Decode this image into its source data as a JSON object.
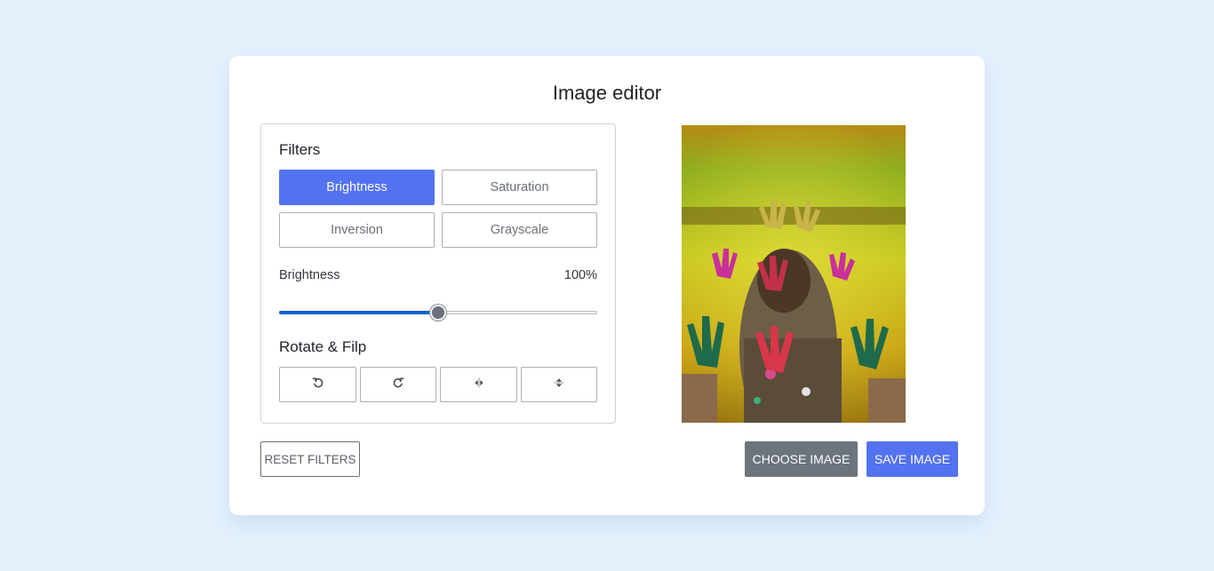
{
  "editor": {
    "title": "Image editor"
  },
  "filters": {
    "heading": "Filters",
    "options": [
      {
        "label": "Brightness",
        "active": true
      },
      {
        "label": "Saturation",
        "active": false
      },
      {
        "label": "Inversion",
        "active": false
      },
      {
        "label": "Grayscale",
        "active": false
      }
    ]
  },
  "slider": {
    "name": "Brightness",
    "value_text": "100%",
    "value": 100,
    "min": 0,
    "max": 200
  },
  "rotate": {
    "heading": "Rotate & Filp",
    "buttons": [
      {
        "icon": "rotate-left-icon"
      },
      {
        "icon": "rotate-right-icon"
      },
      {
        "icon": "flip-horizontal-icon"
      },
      {
        "icon": "flip-vertical-icon"
      }
    ]
  },
  "actions": {
    "reset_label": "RESET FILTERS",
    "choose_label": "CHOOSE IMAGE",
    "save_label": "SAVE IMAGE"
  },
  "colors": {
    "background": "#e3f1fd",
    "accent": "#5372f0",
    "secondary": "#6c757d",
    "slider_fill": "#0b63ce"
  }
}
